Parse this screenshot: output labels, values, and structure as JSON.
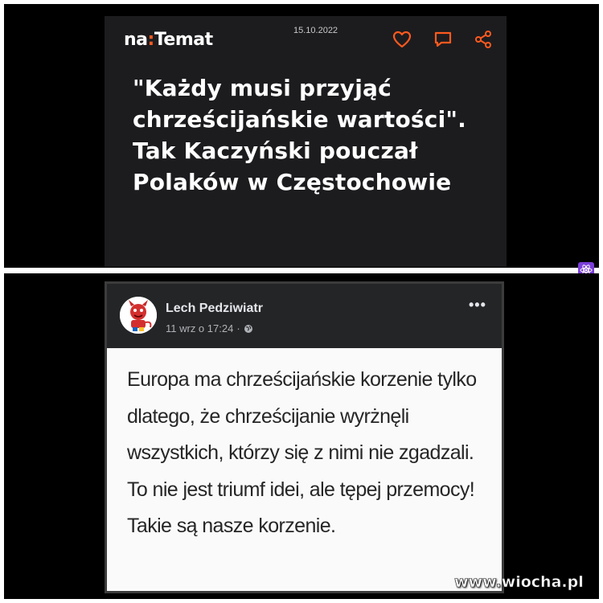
{
  "article": {
    "brand_prefix": "na",
    "brand_sep": ":",
    "brand_name": "Temat",
    "date": "15.10.2022",
    "headline": "\"Każdy musi przyjąć chrześcijańskie wartości\". Tak Kaczyński pouczał Polaków w Częstochowie",
    "icons": [
      "heart-icon",
      "comment-icon",
      "share-icon"
    ],
    "accent_color": "#ff5a1f"
  },
  "post": {
    "author": "Lech Pedziwiatr",
    "timestamp": "11 wrz o 17:24",
    "separator": "·",
    "more_label": "•••",
    "text": "Europa ma chrześcijańskie korzenie tylko dlatego, że chrześcijanie wyrżnęli wszystkich, którzy się z nimi nie zgadzali. To nie jest triumf idei, ale tępej przemocy! Takie są nasze korzenie."
  },
  "watermark": "www.wiocha.pl"
}
